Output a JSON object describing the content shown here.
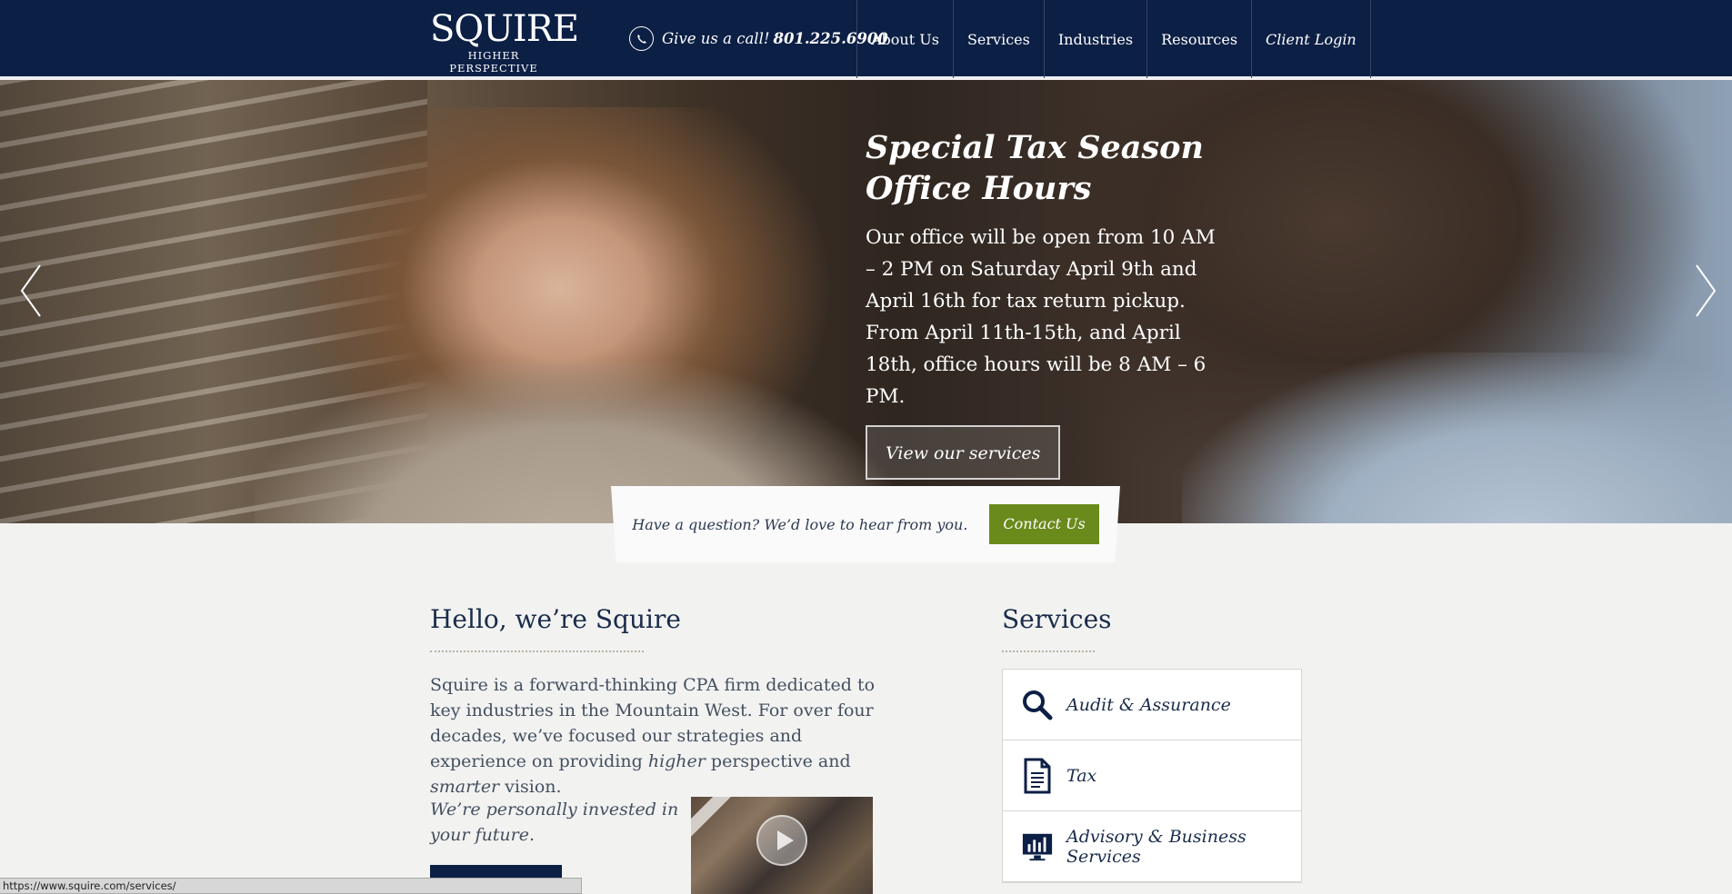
{
  "header": {
    "logo_word": "SQUIRE",
    "logo_tagline": "HIGHER PERSPECTIVE",
    "call_label": "Give us a call!",
    "phone": "801.225.6900",
    "nav": [
      "About Us",
      "Services",
      "Industries",
      "Resources",
      "Client Login"
    ]
  },
  "hero": {
    "title_line1": "Special Tax Season",
    "title_line2": "Office Hours",
    "body": "Our office will be open from 10 AM – 2 PM on Saturday April 9th and April 16th for tax return pickup. From April 11th-15th, and April 18th, office hours will be 8 AM – 6 PM.",
    "button": "View our services"
  },
  "contact": {
    "question": "Have a question? We’d love to hear from you.",
    "button": "Contact Us"
  },
  "about": {
    "title": "Hello, we’re Squire",
    "para_start": "Squire is a forward-thinking CPA firm dedicated to key industries in the Mountain West. For over four decades, we’ve focused our strategies and experience on providing ",
    "em1": "higher",
    "para_mid": " perspective and ",
    "em2": "smarter",
    "para_end": " vision.",
    "invested": "We’re personally invested in your future."
  },
  "services": {
    "title": "Services",
    "items": [
      {
        "label": "Audit & Assurance",
        "icon": "magnifier-icon"
      },
      {
        "label": "Tax",
        "icon": "document-icon"
      },
      {
        "label": "Advisory & Business Services",
        "icon": "chart-monitor-icon"
      }
    ]
  },
  "status_url": "https://www.squire.com/services/",
  "colors": {
    "navy": "#0c1f45",
    "green": "#6b8a1c",
    "background": "#f2f2f1"
  }
}
